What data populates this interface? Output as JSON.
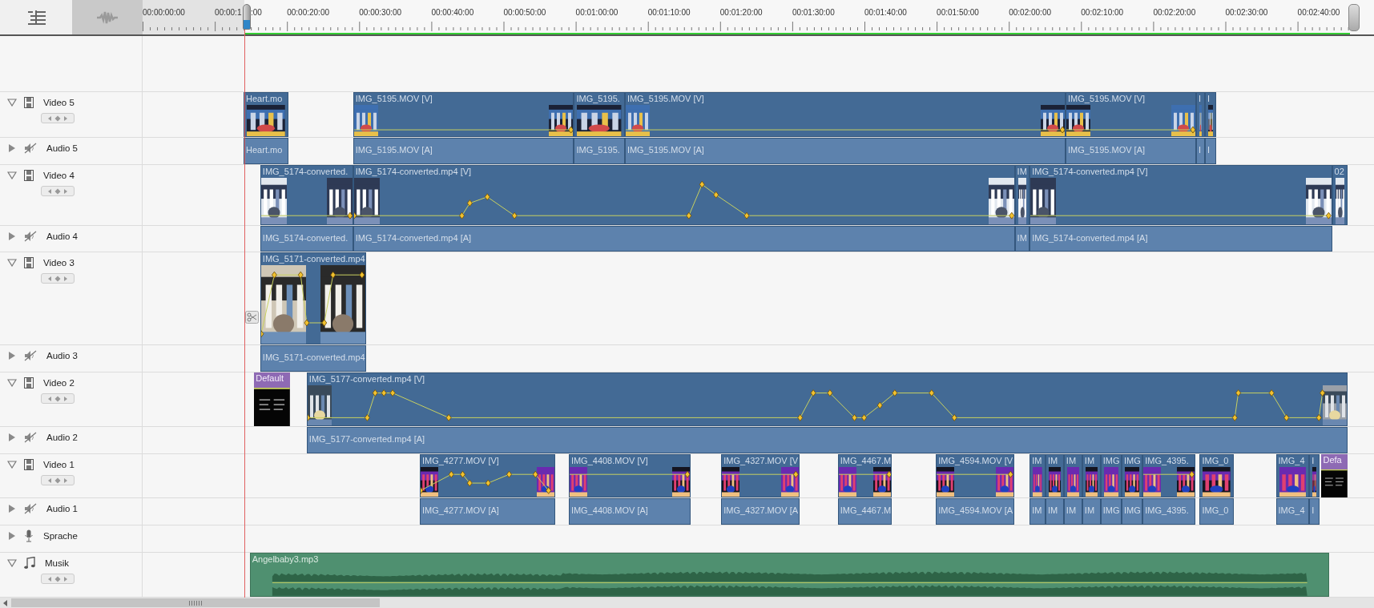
{
  "waveform_toggle": {
    "on": true
  },
  "ruler": {
    "label_tail": ":00",
    "labels": [
      "00:00:00:00",
      "00:00:1",
      "00:00:20:00",
      "00:00:30:00",
      "00:00:40:00",
      "00:00:50:00",
      "00:01:00:00",
      "00:01:10:00",
      "00:01:20:00",
      "00:01:30:00",
      "00:01:40:00",
      "00:01:50:00",
      "00:02:00:00",
      "00:02:10:00",
      "00:02:20:00",
      "00:02:30:00",
      "00:02:40:00"
    ]
  },
  "tracks": [
    {
      "name": "Video 5",
      "kind": "video",
      "expanded": true,
      "clips": [
        {
          "label": "Heart.mo",
          "kind": "video"
        },
        {
          "label": "IMG_5195.MOV [V]",
          "kind": "video"
        },
        {
          "label": "IMG_5195.",
          "kind": "video"
        },
        {
          "label": "IMG_5195.MOV [V]",
          "kind": "video"
        },
        {
          "label": "IMG_5195.MOV [V]",
          "kind": "video"
        },
        {
          "label": "I",
          "kind": "video"
        },
        {
          "label": "I",
          "kind": "video"
        }
      ]
    },
    {
      "name": "Audio 5",
      "kind": "audio",
      "expanded": false,
      "clips": [
        {
          "label": "Heart.mo",
          "kind": "audio"
        },
        {
          "label": "IMG_5195.MOV [A]",
          "kind": "audio"
        },
        {
          "label": "IMG_5195.",
          "kind": "audio"
        },
        {
          "label": "IMG_5195.MOV [A]",
          "kind": "audio"
        },
        {
          "label": "IMG_5195.MOV [A]",
          "kind": "audio"
        },
        {
          "label": "I",
          "kind": "audio"
        },
        {
          "label": "I",
          "kind": "audio"
        }
      ]
    },
    {
      "name": "Video 4",
      "kind": "video",
      "expanded": true,
      "clips": [
        {
          "label": "IMG_5174-converted.",
          "kind": "video"
        },
        {
          "label": "IMG_5174-converted.mp4 [V]",
          "kind": "video"
        },
        {
          "label": "IM",
          "kind": "video"
        },
        {
          "label": "IMG_5174-converted.mp4 [V]",
          "kind": "video"
        },
        {
          "label": "02",
          "kind": "video"
        }
      ]
    },
    {
      "name": "Audio 4",
      "kind": "audio",
      "expanded": false,
      "clips": [
        {
          "label": "IMG_5174-converted.",
          "kind": "audio"
        },
        {
          "label": "IMG_5174-converted.mp4 [A]",
          "kind": "audio"
        },
        {
          "label": "IM",
          "kind": "audio"
        },
        {
          "label": "IMG_5174-converted.mp4 [A]",
          "kind": "audio"
        }
      ]
    },
    {
      "name": "Video 3",
      "kind": "video",
      "expanded": true,
      "clips": [
        {
          "label": "IMG_5171-converted.mp4",
          "kind": "video"
        }
      ]
    },
    {
      "name": "Audio 3",
      "kind": "audio",
      "expanded": false,
      "clips": [
        {
          "label": "IMG_5171-converted.mp4",
          "kind": "audio"
        }
      ]
    },
    {
      "name": "Video 2",
      "kind": "video",
      "expanded": true,
      "clips": [
        {
          "label": "Default",
          "kind": "title"
        },
        {
          "label": "IMG_5177-converted.mp4 [V]",
          "kind": "video"
        }
      ]
    },
    {
      "name": "Audio 2",
      "kind": "audio",
      "expanded": false,
      "clips": [
        {
          "label": "IMG_5177-converted.mp4 [A]",
          "kind": "audio"
        }
      ]
    },
    {
      "name": "Video 1",
      "kind": "video",
      "expanded": true,
      "clips": [
        {
          "label": "IMG_4277.MOV [V]",
          "kind": "video"
        },
        {
          "label": "IMG_4408.MOV [V]",
          "kind": "video"
        },
        {
          "label": "IMG_4327.MOV [V",
          "kind": "video"
        },
        {
          "label": "IMG_4467.M",
          "kind": "video"
        },
        {
          "label": "IMG_4594.MOV [V",
          "kind": "video"
        },
        {
          "label": "IM",
          "kind": "video"
        },
        {
          "label": "IM",
          "kind": "video"
        },
        {
          "label": "IM",
          "kind": "video"
        },
        {
          "label": "IM",
          "kind": "video"
        },
        {
          "label": "IMG",
          "kind": "video"
        },
        {
          "label": "IMG",
          "kind": "video"
        },
        {
          "label": "IMG_4395.",
          "kind": "video"
        },
        {
          "label": "IMG_0",
          "kind": "video"
        },
        {
          "label": "IMG_4",
          "kind": "video"
        },
        {
          "label": "I",
          "kind": "video"
        },
        {
          "label": "Defa",
          "kind": "title"
        }
      ]
    },
    {
      "name": "Audio 1",
      "kind": "audio",
      "expanded": false,
      "clips": [
        {
          "label": "IMG_4277.MOV [A]",
          "kind": "audio"
        },
        {
          "label": "IMG_4408.MOV [A]",
          "kind": "audio"
        },
        {
          "label": "IMG_4327.MOV [A",
          "kind": "audio"
        },
        {
          "label": "IMG_4467.M",
          "kind": "audio"
        },
        {
          "label": "IMG_4594.MOV [A",
          "kind": "audio"
        },
        {
          "label": "IM",
          "kind": "audio"
        },
        {
          "label": "IM",
          "kind": "audio"
        },
        {
          "label": "IM",
          "kind": "audio"
        },
        {
          "label": "IM",
          "kind": "audio"
        },
        {
          "label": "IMG",
          "kind": "audio"
        },
        {
          "label": "IMG",
          "kind": "audio"
        },
        {
          "label": "IMG_4395.",
          "kind": "audio"
        },
        {
          "label": "IMG_0",
          "kind": "audio"
        },
        {
          "label": "IMG_4",
          "kind": "audio"
        },
        {
          "label": "I",
          "kind": "audio"
        }
      ]
    },
    {
      "name": "Sprache",
      "kind": "voice",
      "expanded": false
    },
    {
      "name": "Musik",
      "kind": "music",
      "expanded": true,
      "clips": [
        {
          "label": "Angelbaby3.mp3",
          "kind": "music"
        }
      ]
    }
  ]
}
